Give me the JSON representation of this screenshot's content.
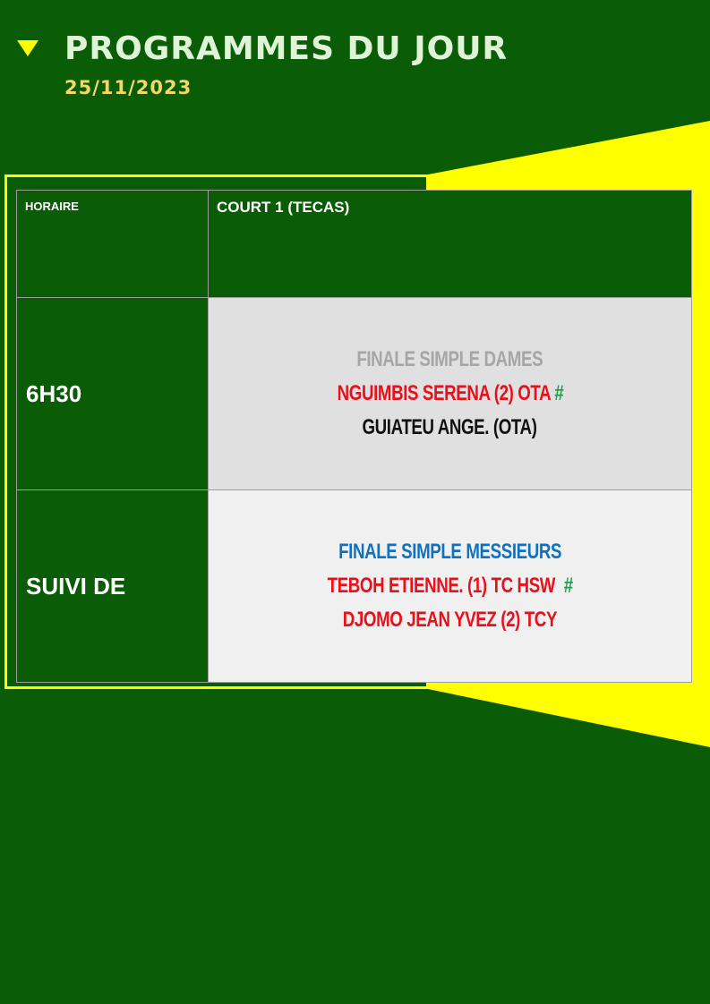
{
  "header": {
    "title": "PROGRAMMES DU JOUR",
    "date": "25/11/2023"
  },
  "table": {
    "col_time_header": "HORAIRE",
    "col_court_header": "COURT 1 (TECAS)",
    "rows": [
      {
        "time": "6H30",
        "event": "FINALE SIMPLE DAMES",
        "player1": "NGUIMBIS SERENA (2) OTA",
        "player1_mark": "#",
        "player2": "GUIATEU ANGE. (OTA)"
      },
      {
        "time": "SUIVI DE",
        "event": "FINALE SIMPLE MESSIEURS",
        "player1": "TEBOH ETIENNE. (1) TC HSW",
        "player1_mark": "#",
        "player2": "DJOMO JEAN YVEZ (2) TCY"
      }
    ]
  },
  "colors": {
    "background": "#0b5c06",
    "accent": "#ffff00",
    "event1": "#a6a6a6",
    "event2": "#0e72c0",
    "player_red": "#e8101b",
    "winner_mark": "#1aa14a"
  }
}
